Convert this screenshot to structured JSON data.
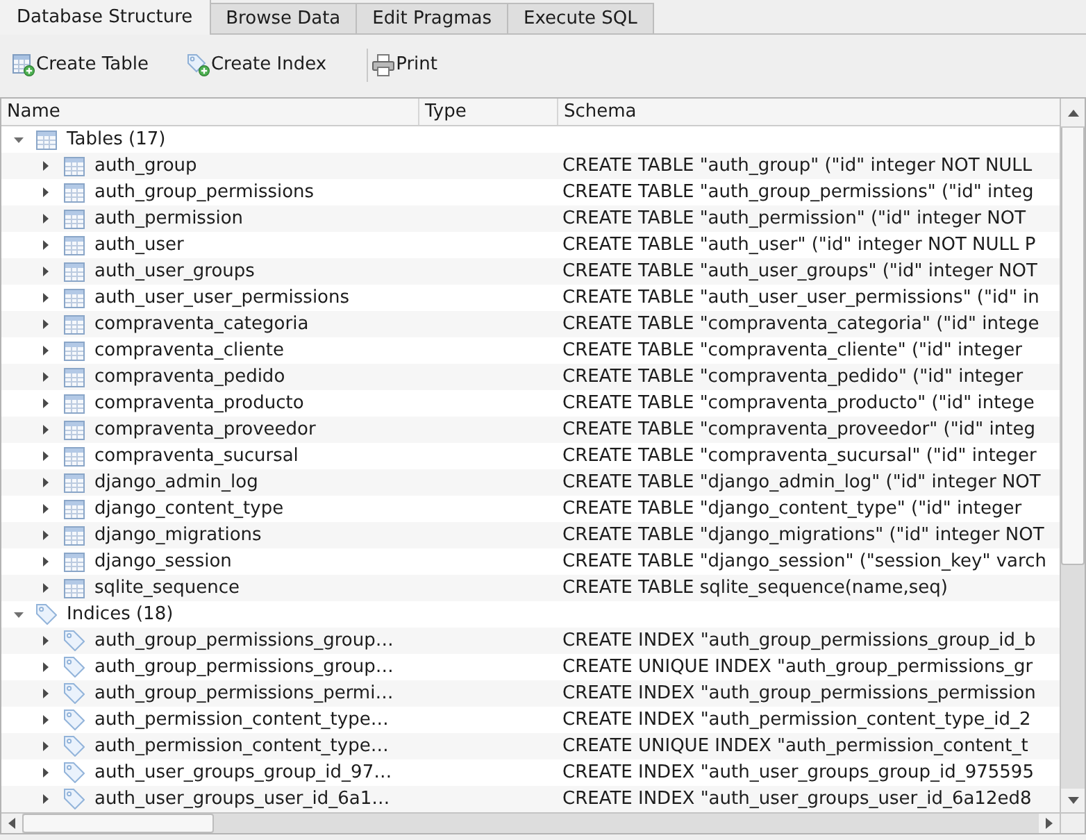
{
  "tabs": [
    {
      "label": "Database Structure",
      "selected": true
    },
    {
      "label": "Browse Data",
      "selected": false
    },
    {
      "label": "Edit Pragmas",
      "selected": false
    },
    {
      "label": "Execute SQL",
      "selected": false
    }
  ],
  "toolbar_groups": [
    [
      {
        "label": "Create Table",
        "kind": "create_table"
      },
      {
        "label": "Create Index",
        "kind": "create_index"
      }
    ],
    [
      {
        "label": "Print",
        "kind": "print"
      }
    ]
  ],
  "columns": [
    "Name",
    "Type",
    "Schema"
  ],
  "tree": [
    {
      "name": "Tables (17)",
      "kind": "table",
      "expanded": true,
      "children": [
        {
          "name": "auth_group",
          "kind": "table",
          "expanded": false,
          "schema": "CREATE TABLE \"auth_group\" (\"id\" integer NOT NULL"
        },
        {
          "name": "auth_group_permissions",
          "kind": "table",
          "expanded": false,
          "schema": "CREATE TABLE \"auth_group_permissions\" (\"id\" integ"
        },
        {
          "name": "auth_permission",
          "kind": "table",
          "expanded": false,
          "schema": "CREATE TABLE \"auth_permission\" (\"id\" integer NOT"
        },
        {
          "name": "auth_user",
          "kind": "table",
          "expanded": false,
          "schema": "CREATE TABLE \"auth_user\" (\"id\" integer NOT NULL P"
        },
        {
          "name": "auth_user_groups",
          "kind": "table",
          "expanded": false,
          "schema": "CREATE TABLE \"auth_user_groups\" (\"id\" integer NOT"
        },
        {
          "name": "auth_user_user_permissions",
          "kind": "table",
          "expanded": false,
          "schema": "CREATE TABLE \"auth_user_user_permissions\" (\"id\" in"
        },
        {
          "name": "compraventa_categoria",
          "kind": "table",
          "expanded": false,
          "schema": "CREATE TABLE \"compraventa_categoria\" (\"id\" intege"
        },
        {
          "name": "compraventa_cliente",
          "kind": "table",
          "expanded": false,
          "schema": "CREATE TABLE \"compraventa_cliente\" (\"id\" integer"
        },
        {
          "name": "compraventa_pedido",
          "kind": "table",
          "expanded": false,
          "schema": "CREATE TABLE \"compraventa_pedido\" (\"id\" integer"
        },
        {
          "name": "compraventa_producto",
          "kind": "table",
          "expanded": false,
          "schema": "CREATE TABLE \"compraventa_producto\" (\"id\" intege"
        },
        {
          "name": "compraventa_proveedor",
          "kind": "table",
          "expanded": false,
          "schema": "CREATE TABLE \"compraventa_proveedor\" (\"id\" integ"
        },
        {
          "name": "compraventa_sucursal",
          "kind": "table",
          "expanded": false,
          "schema": "CREATE TABLE \"compraventa_sucursal\" (\"id\" integer"
        },
        {
          "name": "django_admin_log",
          "kind": "table",
          "expanded": false,
          "schema": "CREATE TABLE \"django_admin_log\" (\"id\" integer NOT"
        },
        {
          "name": "django_content_type",
          "kind": "table",
          "expanded": false,
          "schema": "CREATE TABLE \"django_content_type\" (\"id\" integer"
        },
        {
          "name": "django_migrations",
          "kind": "table",
          "expanded": false,
          "schema": "CREATE TABLE \"django_migrations\" (\"id\" integer NOT"
        },
        {
          "name": "django_session",
          "kind": "table",
          "expanded": false,
          "schema": "CREATE TABLE \"django_session\" (\"session_key\" varch"
        },
        {
          "name": "sqlite_sequence",
          "kind": "table",
          "expanded": false,
          "schema": "CREATE TABLE sqlite_sequence(name,seq)"
        }
      ]
    },
    {
      "name": "Indices (18)",
      "kind": "index",
      "expanded": true,
      "children": [
        {
          "name": "auth_group_permissions_group…",
          "kind": "index",
          "expanded": false,
          "schema": "CREATE INDEX \"auth_group_permissions_group_id_b"
        },
        {
          "name": "auth_group_permissions_group…",
          "kind": "index",
          "expanded": false,
          "schema": "CREATE UNIQUE INDEX \"auth_group_permissions_gr"
        },
        {
          "name": "auth_group_permissions_permi…",
          "kind": "index",
          "expanded": false,
          "schema": "CREATE INDEX \"auth_group_permissions_permission"
        },
        {
          "name": "auth_permission_content_type…",
          "kind": "index",
          "expanded": false,
          "schema": "CREATE INDEX \"auth_permission_content_type_id_2"
        },
        {
          "name": "auth_permission_content_type…",
          "kind": "index",
          "expanded": false,
          "schema": "CREATE UNIQUE INDEX \"auth_permission_content_t"
        },
        {
          "name": "auth_user_groups_group_id_97…",
          "kind": "index",
          "expanded": false,
          "schema": "CREATE INDEX \"auth_user_groups_group_id_975595"
        },
        {
          "name": "auth_user_groups_user_id_6a1…",
          "kind": "index",
          "expanded": false,
          "schema": "CREATE INDEX \"auth_user_groups_user_id_6a12ed8"
        }
      ]
    }
  ]
}
